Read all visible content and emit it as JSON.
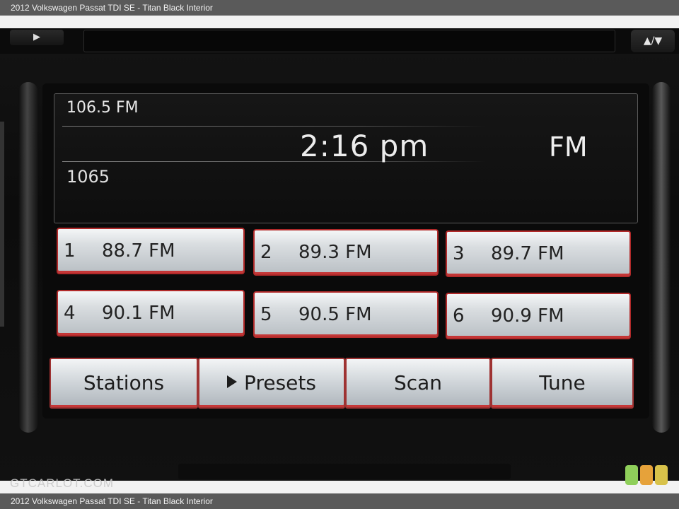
{
  "caption": {
    "top": "2012 Volkswagen Passat TDI SE - Titan Black Interior",
    "bottom": "2012 Volkswagen Passat TDI SE - Titan Black Interior"
  },
  "unit": {
    "eject_symbol": "▶",
    "up_down_symbol": "▲/▼"
  },
  "radio": {
    "frequency": "106.5 FM",
    "time": "2:16 pm",
    "band": "FM",
    "station_id": "1065"
  },
  "presets": [
    {
      "num": "1",
      "freq": "88.7 FM"
    },
    {
      "num": "2",
      "freq": "89.3 FM"
    },
    {
      "num": "3",
      "freq": "89.7 FM"
    },
    {
      "num": "4",
      "freq": "90.1 FM"
    },
    {
      "num": "5",
      "freq": "90.5 FM"
    },
    {
      "num": "6",
      "freq": "90.9 FM"
    }
  ],
  "softkeys": {
    "stations": "Stations",
    "presets": "Presets",
    "scan": "Scan",
    "tune": "Tune"
  },
  "watermark": "GTCARLOT.COM",
  "colors": {
    "accent_red": "#c43636",
    "dot1": "#8fcf5a",
    "dot2": "#e6a23a",
    "dot3": "#d8c24a"
  }
}
